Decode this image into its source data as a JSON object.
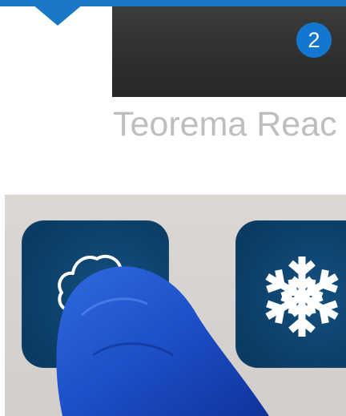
{
  "header": {
    "step_number": "2",
    "brand_text": "Teorema Reac"
  },
  "tiles": [
    {
      "name": "weather-tile",
      "icon": "cloud-icon"
    },
    {
      "name": "freeze-tile",
      "icon": "snowflake-icon"
    }
  ],
  "colors": {
    "accent_blue": "#1978c6",
    "tile_blue": "#0b3b63",
    "glove_blue": "#1a47c4",
    "brand_gray": "#bebebe"
  }
}
